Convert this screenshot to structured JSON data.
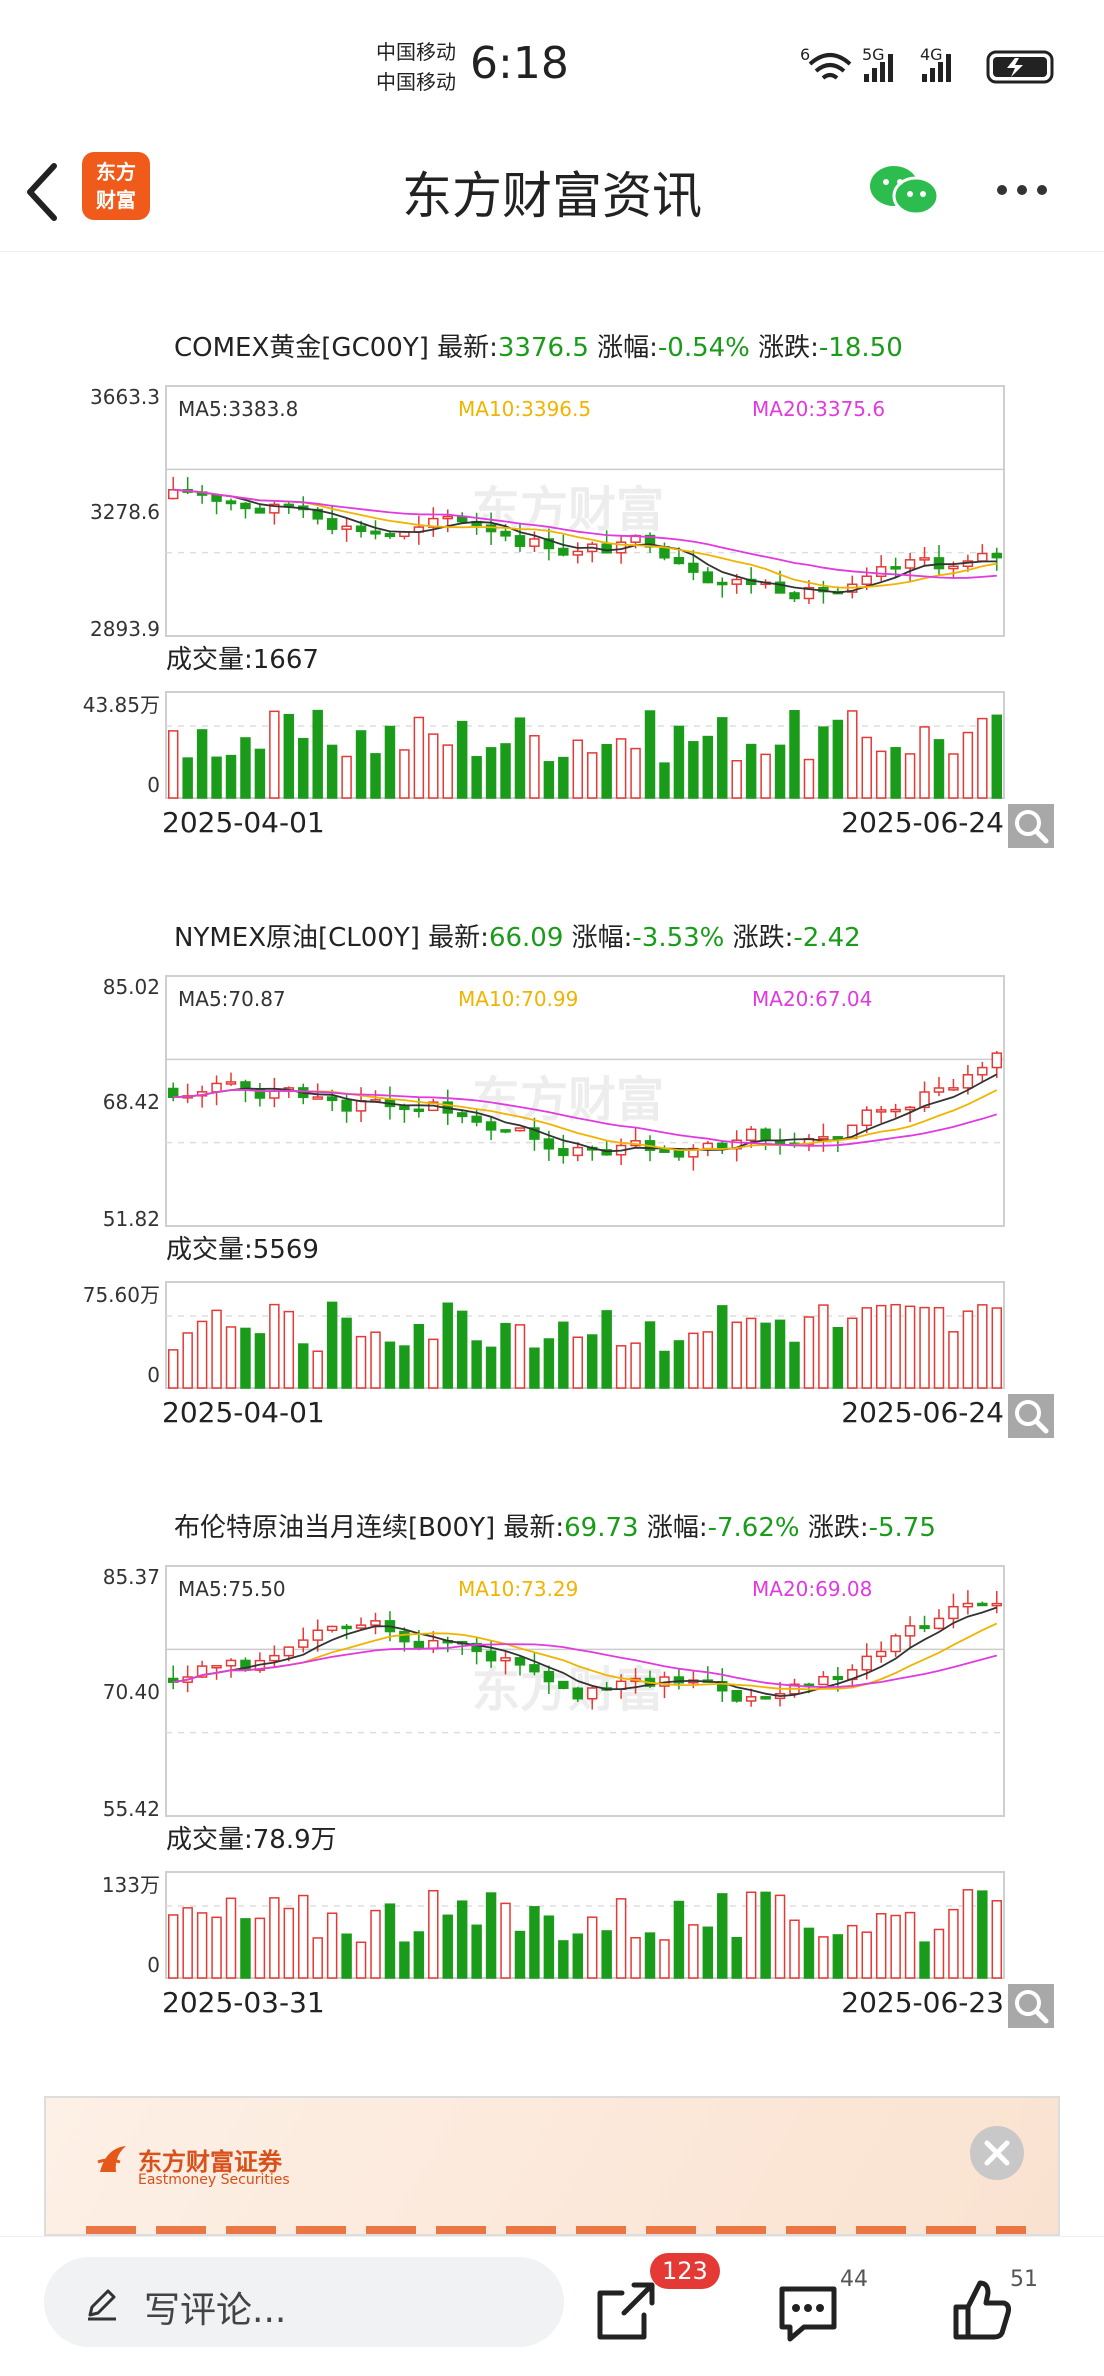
{
  "status_bar": {
    "carrier1": "中国移动",
    "carrier2": "中国移动",
    "time": "6:18",
    "net1": "6",
    "net2": "5G",
    "net3": "4G"
  },
  "nav": {
    "title": "东方财富资讯",
    "logo_line1": "东方",
    "logo_line2": "财富"
  },
  "watermark": "东方财富",
  "charts": [
    {
      "name_label": "COMEX黄金[GC00Y]",
      "latest_label": "最新:",
      "latest": "3376.5",
      "pct_label": "涨幅:",
      "pct": "-0.54%",
      "chg_label": "涨跌:",
      "chg": "-18.50",
      "ma5": "MA5:3383.8",
      "ma10": "MA10:3396.5",
      "ma20": "MA20:3375.6",
      "y_ticks": [
        "3663.3",
        "3278.6",
        "2893.9"
      ],
      "volume_label": "成交量:1667",
      "vol_tick_top": "43.85万",
      "vol_tick_bottom": "0",
      "date_start": "2025-04-01",
      "date_end": "2025-06-24"
    },
    {
      "name_label": "NYMEX原油[CL00Y]",
      "latest_label": "最新:",
      "latest": "66.09",
      "pct_label": "涨幅:",
      "pct": "-3.53%",
      "chg_label": "涨跌:",
      "chg": "-2.42",
      "ma5": "MA5:70.87",
      "ma10": "MA10:70.99",
      "ma20": "MA20:67.04",
      "y_ticks": [
        "85.02",
        "68.42",
        "51.82"
      ],
      "volume_label": "成交量:5569",
      "vol_tick_top": "75.60万",
      "vol_tick_bottom": "0",
      "date_start": "2025-04-01",
      "date_end": "2025-06-24"
    },
    {
      "name_label": "布伦特原油当月连续[B00Y]",
      "latest_label": "最新:",
      "latest": "69.73",
      "pct_label": "涨幅:",
      "pct": "-7.62%",
      "chg_label": "涨跌:",
      "chg": "-5.75",
      "ma5": "MA5:75.50",
      "ma10": "MA10:73.29",
      "ma20": "MA20:69.08",
      "y_ticks": [
        "85.37",
        "70.40",
        "55.42"
      ],
      "volume_label": "成交量:78.9万",
      "vol_tick_top": "133万",
      "vol_tick_bottom": "0",
      "date_start": "2025-03-31",
      "date_end": "2025-06-23"
    }
  ],
  "ad": {
    "brand": "东方财富证券",
    "brand_en": "Eastmoney Securities"
  },
  "bottom": {
    "comment_placeholder": "写评论...",
    "share_count": "123",
    "comment_count": "44",
    "like_count": "51"
  },
  "colors": {
    "up": "#e53935",
    "down": "#1a9c1a",
    "ma5": "#333333",
    "ma10": "#f0b400",
    "ma20": "#e03ae0",
    "brand": "#f05a1a"
  }
}
